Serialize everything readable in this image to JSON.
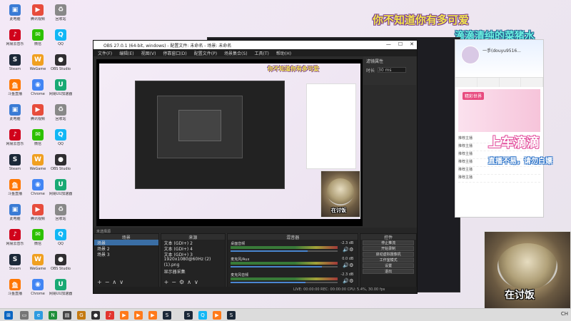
{
  "overlay": {
    "title_top": "你不知道你有多可爱",
    "title_right": "滴滴清纯的菜猪水",
    "big_text": "上车滴滴",
    "sub_text": "直播不易，请勿白嫖",
    "cam_label": "在讨饭",
    "mini_title": "你不知道你有多可爱",
    "mini_cam_label": "在讨饭"
  },
  "desktop_icons": [
    {
      "label": "此电脑",
      "color": "#3a7bd5",
      "glyph": "▣"
    },
    {
      "label": "腾讯视频",
      "color": "#e74c3c",
      "glyph": "▶"
    },
    {
      "label": "回收站",
      "color": "#888888",
      "glyph": "♻"
    },
    {
      "label": "网易云音乐",
      "color": "#d0021b",
      "glyph": "♪"
    },
    {
      "label": "微信",
      "color": "#2dc100",
      "glyph": "✉"
    },
    {
      "label": "QQ",
      "color": "#12b7f5",
      "glyph": "Q"
    },
    {
      "label": "Steam",
      "color": "#1b2838",
      "glyph": "S"
    },
    {
      "label": "WeGame",
      "color": "#f0a020",
      "glyph": "W"
    },
    {
      "label": "OBS Studio",
      "color": "#302e31",
      "glyph": "●"
    },
    {
      "label": "斗鱼直播",
      "color": "#ff7700",
      "glyph": "鱼"
    },
    {
      "label": "Chrome",
      "color": "#4285f4",
      "glyph": "◉"
    },
    {
      "label": "网易UU加速器",
      "color": "#19a974",
      "glyph": "U"
    }
  ],
  "obs": {
    "title": "OBS 27.0.1 (64-bit, windows) - 配置文件: 未命名 - 场景: 未命名",
    "menu": [
      "文件(F)",
      "编辑(E)",
      "视图(V)",
      "停靠窗口(D)",
      "配置文件(P)",
      "场景集合(S)",
      "工具(T)",
      "帮助(H)"
    ],
    "props_title": "滤镜属性",
    "props_rows": [
      {
        "label": "时长",
        "value": "30 ms"
      }
    ],
    "dock_bar_label": "未选择源",
    "scenes_title": "场景",
    "scenes": [
      "场景",
      "场景 2",
      "场景 3"
    ],
    "sources_title": "来源",
    "sources": [
      "文本 (GDI+) 2",
      "文本 (GDI+) 4",
      "文本 (GDI+) 3",
      "1920x1080@60Hz (2)",
      "(1).png",
      "显示器采集"
    ],
    "mixer_title": "混音器",
    "mixer": [
      {
        "label": "桌面音频",
        "db": "-2.3 dB",
        "level": 0.72
      },
      {
        "label": "麦克风/Aux",
        "db": "0.0 dB",
        "level": 0.85
      },
      {
        "label": "麦克风音频",
        "db": "-2.3 dB",
        "level": 0.7
      }
    ],
    "controls_title": "控件",
    "controls": [
      "停止推流",
      "开始录制",
      "启动虚拟摄像机",
      "工作室模式",
      "设置",
      "退出"
    ],
    "status": "LIVE: 00:00:00   REC: 00:00:00   CPU: 5.4%, 30.00 fps"
  },
  "room": {
    "uname": "一手(douyu9516...",
    "banner_tag": "精彩世界",
    "list": [
      "推荐主播",
      "推荐主播",
      "推荐主播",
      "推荐主播",
      "推荐主播",
      "推荐主播"
    ]
  },
  "taskbar": {
    "tray_time": "CH"
  }
}
